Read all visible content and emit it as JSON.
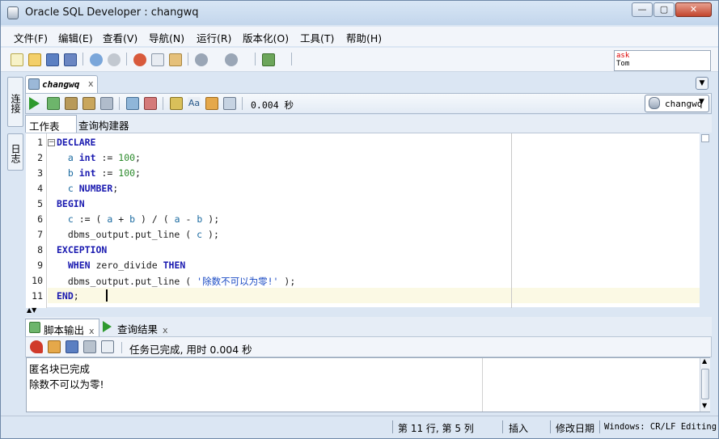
{
  "window": {
    "title": "Oracle SQL Developer : changwq",
    "minimize": "—",
    "maximize": "▢",
    "close": "✕"
  },
  "menu": [
    "文件(F)",
    "编辑(E)",
    "查看(V)",
    "导航(N)",
    "运行(R)",
    "版本化(O)",
    "工具(T)",
    "帮助(H)"
  ],
  "toolbar": {
    "ask_line1": "ask",
    "ask_line2": "Tom"
  },
  "left_tabs": {
    "connections": "连接",
    "log": "日志"
  },
  "editor_tab": {
    "label": "changwq",
    "close": "x"
  },
  "editor_toolbar": {
    "elapsed": "0.004 秒",
    "connection": "changwq"
  },
  "subtabs": {
    "worksheet": "工作表",
    "query_builder": "查询构建器"
  },
  "code": {
    "line_numbers": [
      "1",
      "2",
      "3",
      "4",
      "5",
      "6",
      "7",
      "8",
      "9",
      "10",
      "11"
    ],
    "lines": [
      "DECLARE",
      "  a int := 100;",
      "  b int := 100;",
      "  c NUMBER;",
      "BEGIN",
      "  c := ( a + b ) / ( a - b );",
      "  dbms_output.put_line ( c );",
      "EXCEPTION",
      "  WHEN zero_divide THEN",
      "  dbms_output.put_line ( '除数不可以为零!' );",
      "END;"
    ]
  },
  "output_tabs": {
    "script_output": "脚本输出",
    "query_result": "查询结果",
    "close": "x"
  },
  "output_toolbar": {
    "status": "任务已完成, 用时 0.004 秒"
  },
  "output": {
    "lines": [
      "匿名块已完成",
      "除数不可以为零!"
    ]
  },
  "statusbar": {
    "position": "第 11 行, 第 5 列",
    "mode": "插入",
    "modified": "修改日期",
    "encoding": "Windows: CR/LF Editing"
  },
  "colors": {
    "keyword": "#1a1ab0",
    "identifier": "#1a6aa0",
    "number": "#2b8a2b",
    "string": "#1c4cc4",
    "current_line": "#fbf9e4"
  }
}
